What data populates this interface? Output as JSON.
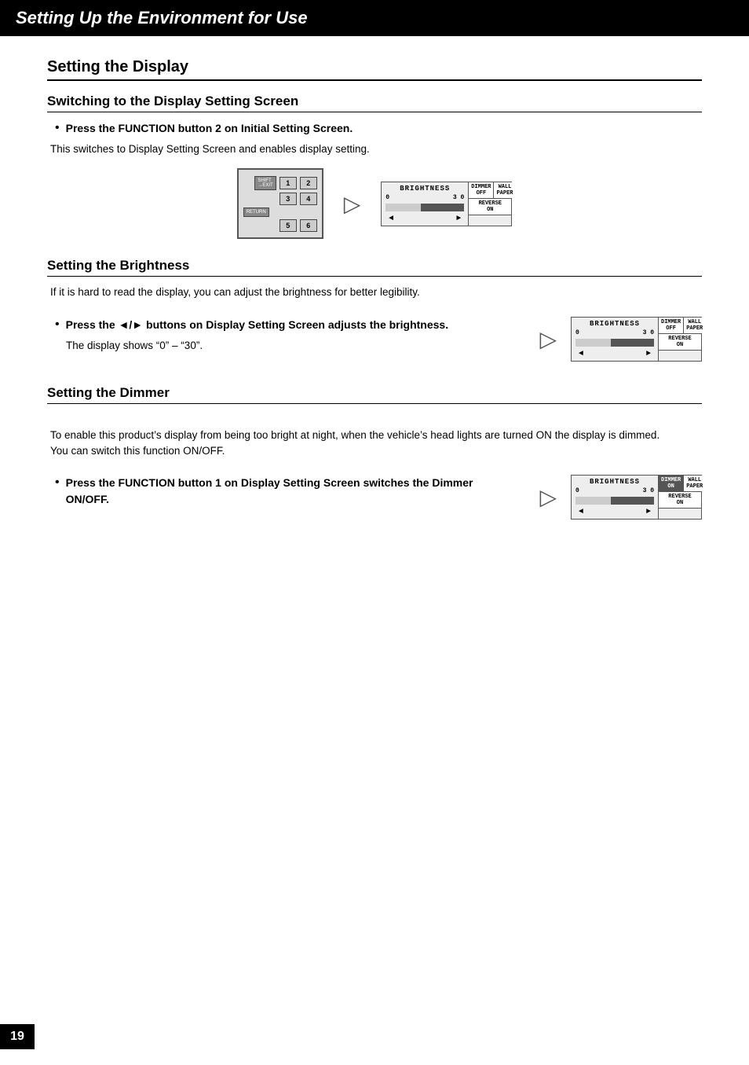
{
  "page": {
    "title": "Setting Up the Environment for Use",
    "page_number": "19",
    "section": {
      "label": "Setting the Display",
      "subsections": [
        {
          "id": "switching",
          "title": "Switching to the Display Setting Screen",
          "bullet": "Press the FUNCTION button 2 on Initial Setting Screen.",
          "body": "This switches to Display Setting Screen and enables display setting."
        },
        {
          "id": "brightness",
          "title": "Setting the Brightness",
          "intro": "If it is hard to read the display, you can adjust the brightness for better legibility.",
          "bullet": "Press the ◄/► buttons on Display Setting Screen adjusts the brightness.",
          "body": "The display shows “0” – “30”."
        },
        {
          "id": "dimmer",
          "title": "Setting the Dimmer",
          "intro": "To enable this product’s display from being too bright at night, when the vehicle’s head lights are turned ON the display is dimmed.\nYou can switch this function ON/OFF.",
          "bullet": "Press the FUNCTION button 1 on Display Setting Screen switches the Dimmer ON/OFF."
        }
      ]
    }
  },
  "diagrams": {
    "brightness_label": "BRIGHTNESS",
    "dimmer_off_label": "DIMMER\nOFF",
    "dimmer_on_label": "DIMMER\nON",
    "wallpaper_label": "WALL\nPAPER",
    "reverse_on_label": "REVERSE\nON",
    "nav_left": "◄",
    "nav_right": "►",
    "zero_label": "0",
    "thirty_label": "3 0"
  }
}
